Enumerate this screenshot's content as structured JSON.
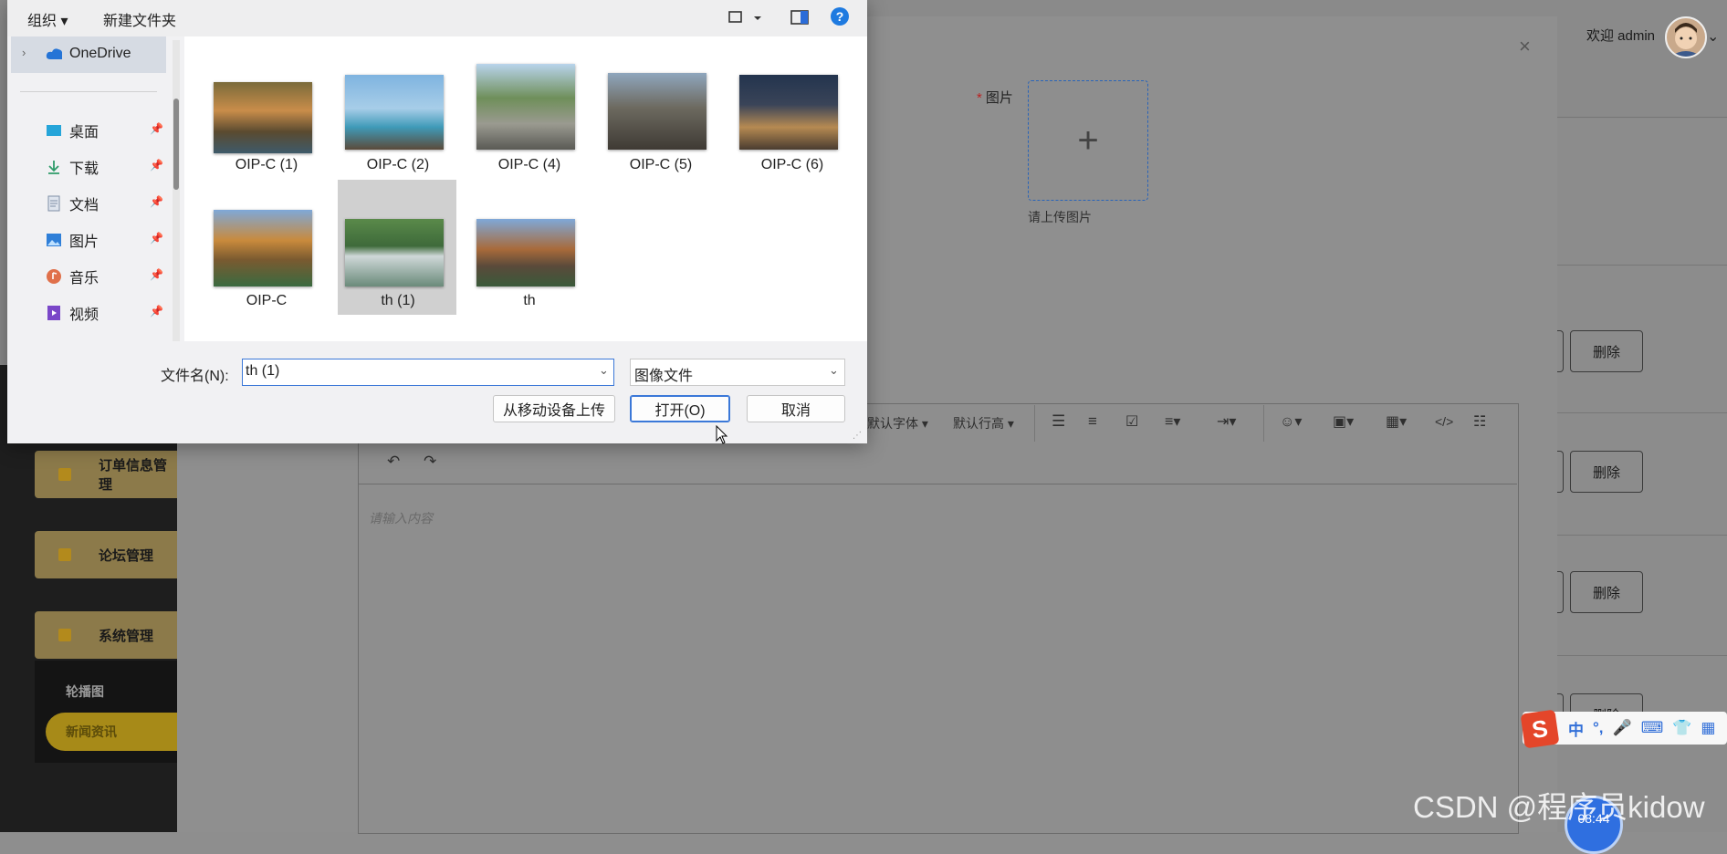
{
  "header": {
    "welcome": "欢迎 admin"
  },
  "sidebar": {
    "menus": [
      "订单信息管理",
      "论坛管理",
      "系统管理"
    ],
    "submenus": [
      "轮播图",
      "新闻资讯"
    ]
  },
  "table": {
    "delete_label": "删除"
  },
  "modal": {
    "close_icon": "×",
    "image_label": "图片",
    "upload_icon": "+",
    "upload_tip": "请上传图片"
  },
  "editor": {
    "toolbar": {
      "font_family": "默认字体",
      "line_height": "默认行高"
    },
    "placeholder": "请输入内容"
  },
  "file_dialog": {
    "organize": "组织",
    "new_folder": "新建文件夹",
    "help_icon": "?",
    "nav": {
      "onedrive": "OneDrive",
      "items": [
        "桌面",
        "下载",
        "文档",
        "图片",
        "音乐",
        "视频"
      ]
    },
    "files": [
      "OIP-C (1)",
      "OIP-C (2)",
      "OIP-C (4)",
      "OIP-C (5)",
      "OIP-C (6)",
      "OIP-C",
      "th (1)",
      "th"
    ],
    "selected_file": "th (1)",
    "filename_label": "文件名(N):",
    "filename_value": "th (1)",
    "filetype_value": "图像文件",
    "upload_mobile": "从移动设备上传",
    "open": "打开(O)",
    "cancel": "取消"
  },
  "ime": {
    "mode": "中"
  },
  "watermark": "CSDN @程序员kidow",
  "clock": "08:44"
}
